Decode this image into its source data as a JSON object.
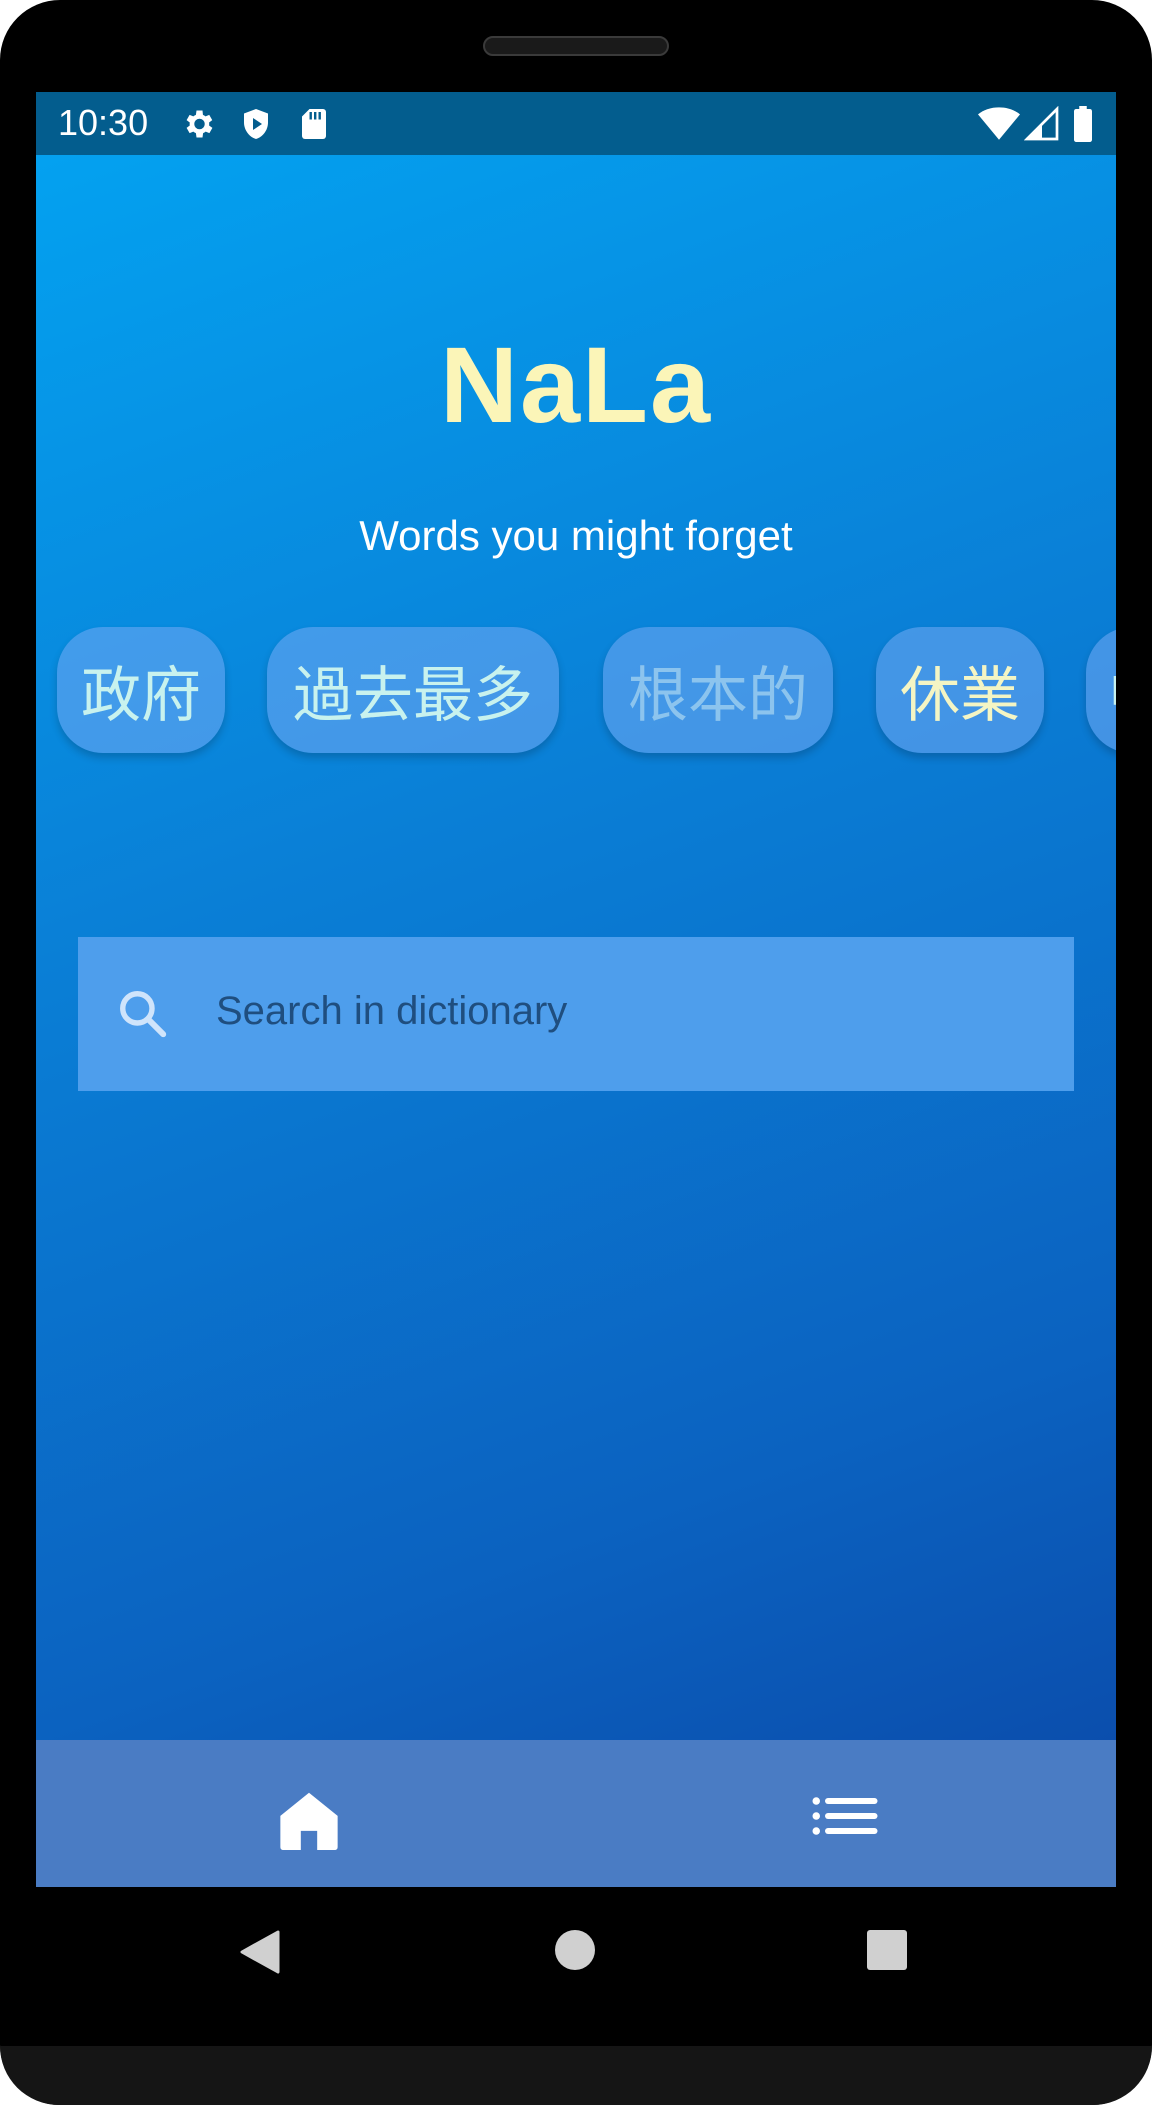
{
  "status_bar": {
    "time": "10:30",
    "left_icons": [
      "settings-icon",
      "shield-play-icon",
      "sd-card-icon"
    ],
    "right_icons": [
      "wifi-icon",
      "cell-signal-icon",
      "battery-icon"
    ]
  },
  "app": {
    "title": "NaLa",
    "subtitle": "Words you might forget",
    "title_color": "#fbf5b8",
    "background_gradient": [
      "#03a4f2",
      "#0b47a6"
    ]
  },
  "words": [
    {
      "text": "政府",
      "color": "#c8f2ee"
    },
    {
      "text": "過去最多",
      "color": "#c8f2ee"
    },
    {
      "text": "根本的",
      "color": "#8cc4ee"
    },
    {
      "text": "休業",
      "color": "#f4f5c4"
    },
    {
      "text": "中",
      "color": "#c8f2ee"
    }
  ],
  "search": {
    "placeholder": "Search in dictionary",
    "icon": "search-icon"
  },
  "bottom_nav": {
    "items": [
      {
        "icon": "home-icon",
        "active": true
      },
      {
        "icon": "list-icon",
        "active": false
      }
    ]
  },
  "system_nav": [
    "back-icon",
    "home-circle-icon",
    "recents-square-icon"
  ]
}
